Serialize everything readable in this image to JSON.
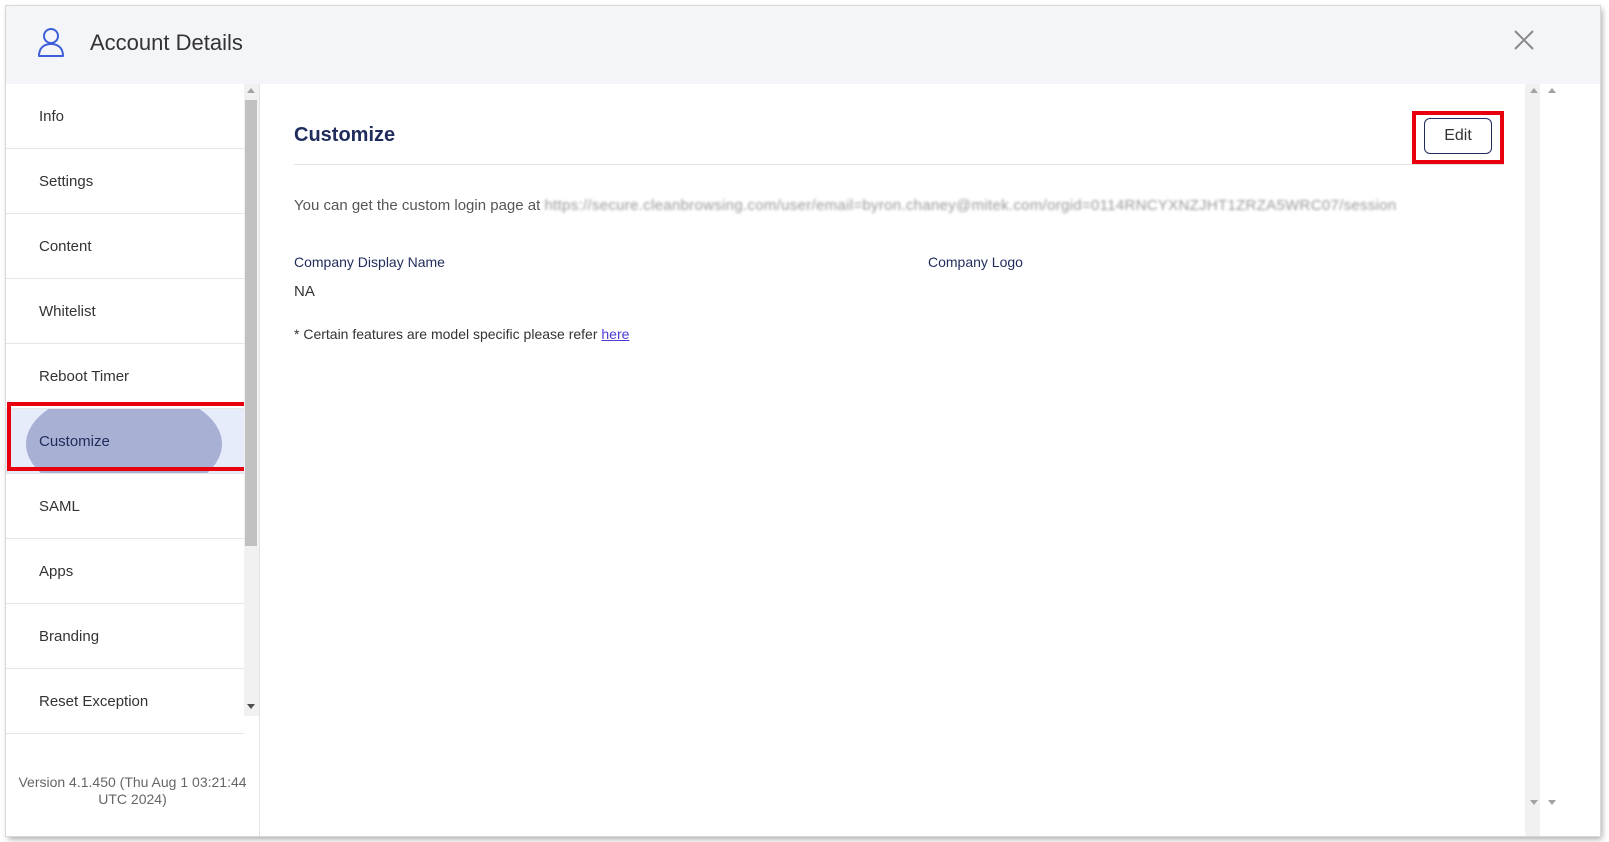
{
  "header": {
    "title": "Account Details",
    "icon": "user-icon",
    "close_icon": "close-icon"
  },
  "sidebar": {
    "items": [
      {
        "label": "Info"
      },
      {
        "label": "Settings"
      },
      {
        "label": "Content"
      },
      {
        "label": "Whitelist"
      },
      {
        "label": "Reboot Timer"
      },
      {
        "label": "Customize",
        "active": true
      },
      {
        "label": "SAML"
      },
      {
        "label": "Apps"
      },
      {
        "label": "Branding"
      },
      {
        "label": "Reset Exception"
      }
    ],
    "version_line1": "Version 4.1.450 (Thu Aug 1 03:21:44",
    "version_line2": "UTC 2024)"
  },
  "main": {
    "title": "Customize",
    "edit_label": "Edit",
    "login_prefix": "You can get the custom login page at",
    "login_url": "https://secure.cleanbrowsing.com/user/email=byron.chaney@mitek.com/orgid=0114RNCYXNZJHT1ZRZA5WRC07/session",
    "fields": {
      "company_display_name_label": "Company Display Name",
      "company_display_name_value": "NA",
      "company_logo_label": "Company Logo"
    },
    "note_text": "* Certain features are model specific please refer",
    "note_link": "here"
  },
  "colors": {
    "accent_navy": "#1f2c5c",
    "highlight_red": "#e8000f",
    "active_bg": "#e7ecfb",
    "link": "#4a3cd6"
  }
}
